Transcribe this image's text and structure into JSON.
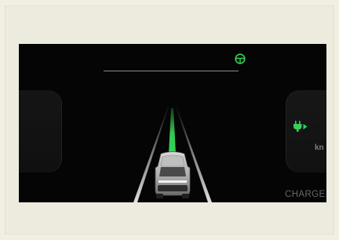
{
  "display": {
    "unit_text": "kn",
    "mode_text": "CHARGE"
  },
  "icons": {
    "steering": "steering-wheel-icon",
    "charging": "ev-plug-icon",
    "vehicle": "vehicle-icon"
  },
  "colors": {
    "accent_green": "#36d158",
    "display_bg": "#050505",
    "page_bg": "#f0efe2"
  }
}
